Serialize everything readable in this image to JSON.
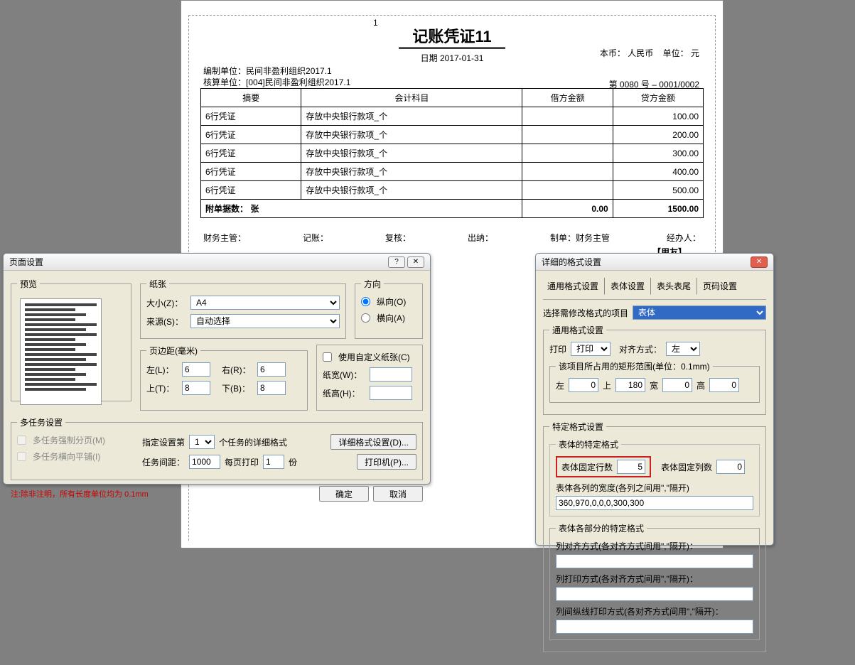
{
  "voucher": {
    "page_number": "1",
    "title": "记账凭证11",
    "date_label": "日期",
    "date": "2017-01-31",
    "currency_label": "本币：",
    "currency": "人民币",
    "unit_label": "单位：",
    "unit": "元",
    "org_label": "编制单位：",
    "org_value": "民间非盈利组织2017.1",
    "account_label": "核算单位：",
    "account_value": "[004]民间非盈利组织2017.1",
    "serial": "第      0080 号   –    0001/0002",
    "cols": {
      "summary": "摘要",
      "subject": "会计科目",
      "debit": "借方金额",
      "credit": "贷方金额"
    },
    "rows": [
      {
        "summary": "6行凭证",
        "subject": "存放中央银行款项_个",
        "debit": "",
        "credit": "100.00"
      },
      {
        "summary": "6行凭证",
        "subject": "存放中央银行款项_个",
        "debit": "",
        "credit": "200.00"
      },
      {
        "summary": "6行凭证",
        "subject": "存放中央银行款项_个",
        "debit": "",
        "credit": "300.00"
      },
      {
        "summary": "6行凭证",
        "subject": "存放中央银行款项_个",
        "debit": "",
        "credit": "400.00"
      },
      {
        "summary": "6行凭证",
        "subject": "存放中央银行款项_个",
        "debit": "",
        "credit": "500.00"
      }
    ],
    "footer_label": "附单据数：    张",
    "footer_debit": "0.00",
    "footer_credit": "1500.00",
    "sign": {
      "s1": "财务主管：",
      "s2": "记账：",
      "s3": "复核：",
      "s4": "出纳：",
      "s5": "制单：财务主管",
      "s6": "经办人："
    },
    "yongyou": "【用友】"
  },
  "page_setup": {
    "title": "页面设置",
    "preview_label": "预览",
    "paper": {
      "legend": "纸张",
      "size_label": "大小(Z)：",
      "size_value": "A4",
      "source_label": "来源(S)：",
      "source_value": "自动选择"
    },
    "orientation": {
      "legend": "方向",
      "portrait": "纵向(O)",
      "landscape": "横向(A)"
    },
    "margins": {
      "legend": "页边距(毫米)",
      "left_label": "左(L)：",
      "left_value": "6",
      "right_label": "右(R)：",
      "right_value": "6",
      "top_label": "上(T)：",
      "top_value": "8",
      "bottom_label": "下(B)：",
      "bottom_value": "8"
    },
    "custom_paper": {
      "check_label": "使用自定义纸张(C)",
      "width_label": "纸宽(W)：",
      "height_label": "纸高(H)："
    },
    "multi": {
      "legend": "多任务设置",
      "force_page": "多任务强制分页(M)",
      "horiz_tile": "多任务横向平铺(I)",
      "specify_label": "指定设置第",
      "specify_value": "1",
      "specify_suffix": "个任务的详细格式",
      "gap_label": "任务间距：",
      "gap_value": "1000",
      "perpage_label": "每页打印",
      "perpage_value": "1",
      "perpage_suffix": "份",
      "detail_btn": "详细格式设置(D)...",
      "printer_btn": "打印机(P)..."
    },
    "note": "注:除非注明，所有长度单位均为 0.1mm",
    "ok": "确定",
    "cancel": "取消"
  },
  "detail": {
    "title": "详细的格式设置",
    "tabs": {
      "general": "通用格式设置",
      "body": "表体设置",
      "header_footer": "表头表尾",
      "pagenum": "页码设置"
    },
    "select_label": "选择需修改格式的项目",
    "select_value": "表体",
    "general": {
      "legend": "通用格式设置",
      "print_label": "打印",
      "print_value": "打印",
      "align_label": "对齐方式：",
      "align_value": "左",
      "rect_legend": "该项目所占用的矩形范围(单位：0.1mm)",
      "left_l": "左",
      "left_v": "0",
      "top_l": "上",
      "top_v": "180",
      "width_l": "宽",
      "width_v": "0",
      "height_l": "高",
      "height_v": "0"
    },
    "specific": {
      "legend": "特定格式设置",
      "sub_legend": "表体的特定格式",
      "fixed_rows_label": "表体固定行数",
      "fixed_rows_value": "5",
      "fixed_cols_label": "表体固定列数",
      "fixed_cols_value": "0",
      "col_width_label": "表体各列的宽度(各列之间用\",\"隔开)",
      "col_width_value": "360,970,0,0,0,300,300",
      "parts_legend": "表体各部分的特定格式",
      "col_align_label": "列对齐方式(各对齐方式间用\",\"隔开)：",
      "col_print_label": "列打印方式(各对齐方式间用\",\"隔开)：",
      "col_vline_label": "列间纵线打印方式(各对齐方式间用\",\"隔开)："
    }
  }
}
